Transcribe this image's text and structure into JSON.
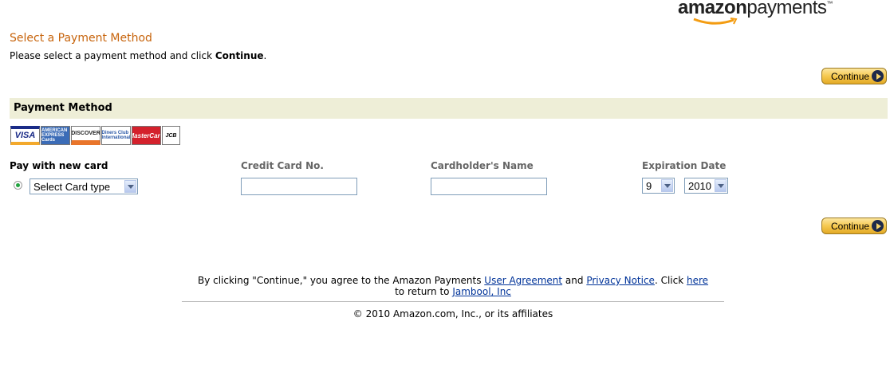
{
  "brand": {
    "part1": "amazon",
    "part2": "payments",
    "tm": "™"
  },
  "page": {
    "title": "Select a Payment Method",
    "instruction_prefix": "Please select a payment method and click ",
    "instruction_bold": "Continue",
    "instruction_suffix": "."
  },
  "buttons": {
    "continue_label": "Continue"
  },
  "section": {
    "title": "Payment Method"
  },
  "cards": [
    "VISA",
    "AMERICAN EXPRESS Cards",
    "DISCOVER",
    "Diners Club International",
    "MasterCard",
    "JCB"
  ],
  "form": {
    "pay_new_card_label": "Pay with new card",
    "card_number_label": "Credit Card No.",
    "cardholder_label": "Cardholder's Name",
    "expiration_label": "Expiration Date",
    "card_type_value": "Select Card type",
    "exp_month_value": "9",
    "exp_year_value": "2010"
  },
  "legal": {
    "text1": "By clicking \"Continue,\" you agree to the Amazon Payments ",
    "user_agreement": "User Agreement",
    "text2": " and ",
    "privacy_notice": "Privacy Notice",
    "text3": ". Click ",
    "here": "here",
    "text4": "to return to ",
    "merchant": "Jambool, Inc"
  },
  "footer": {
    "copyright": "© 2010 Amazon.com, Inc., or its affiliates"
  },
  "colors": {
    "title": "#c7640c",
    "section_bg": "#eeeed7",
    "link": "#003399"
  }
}
